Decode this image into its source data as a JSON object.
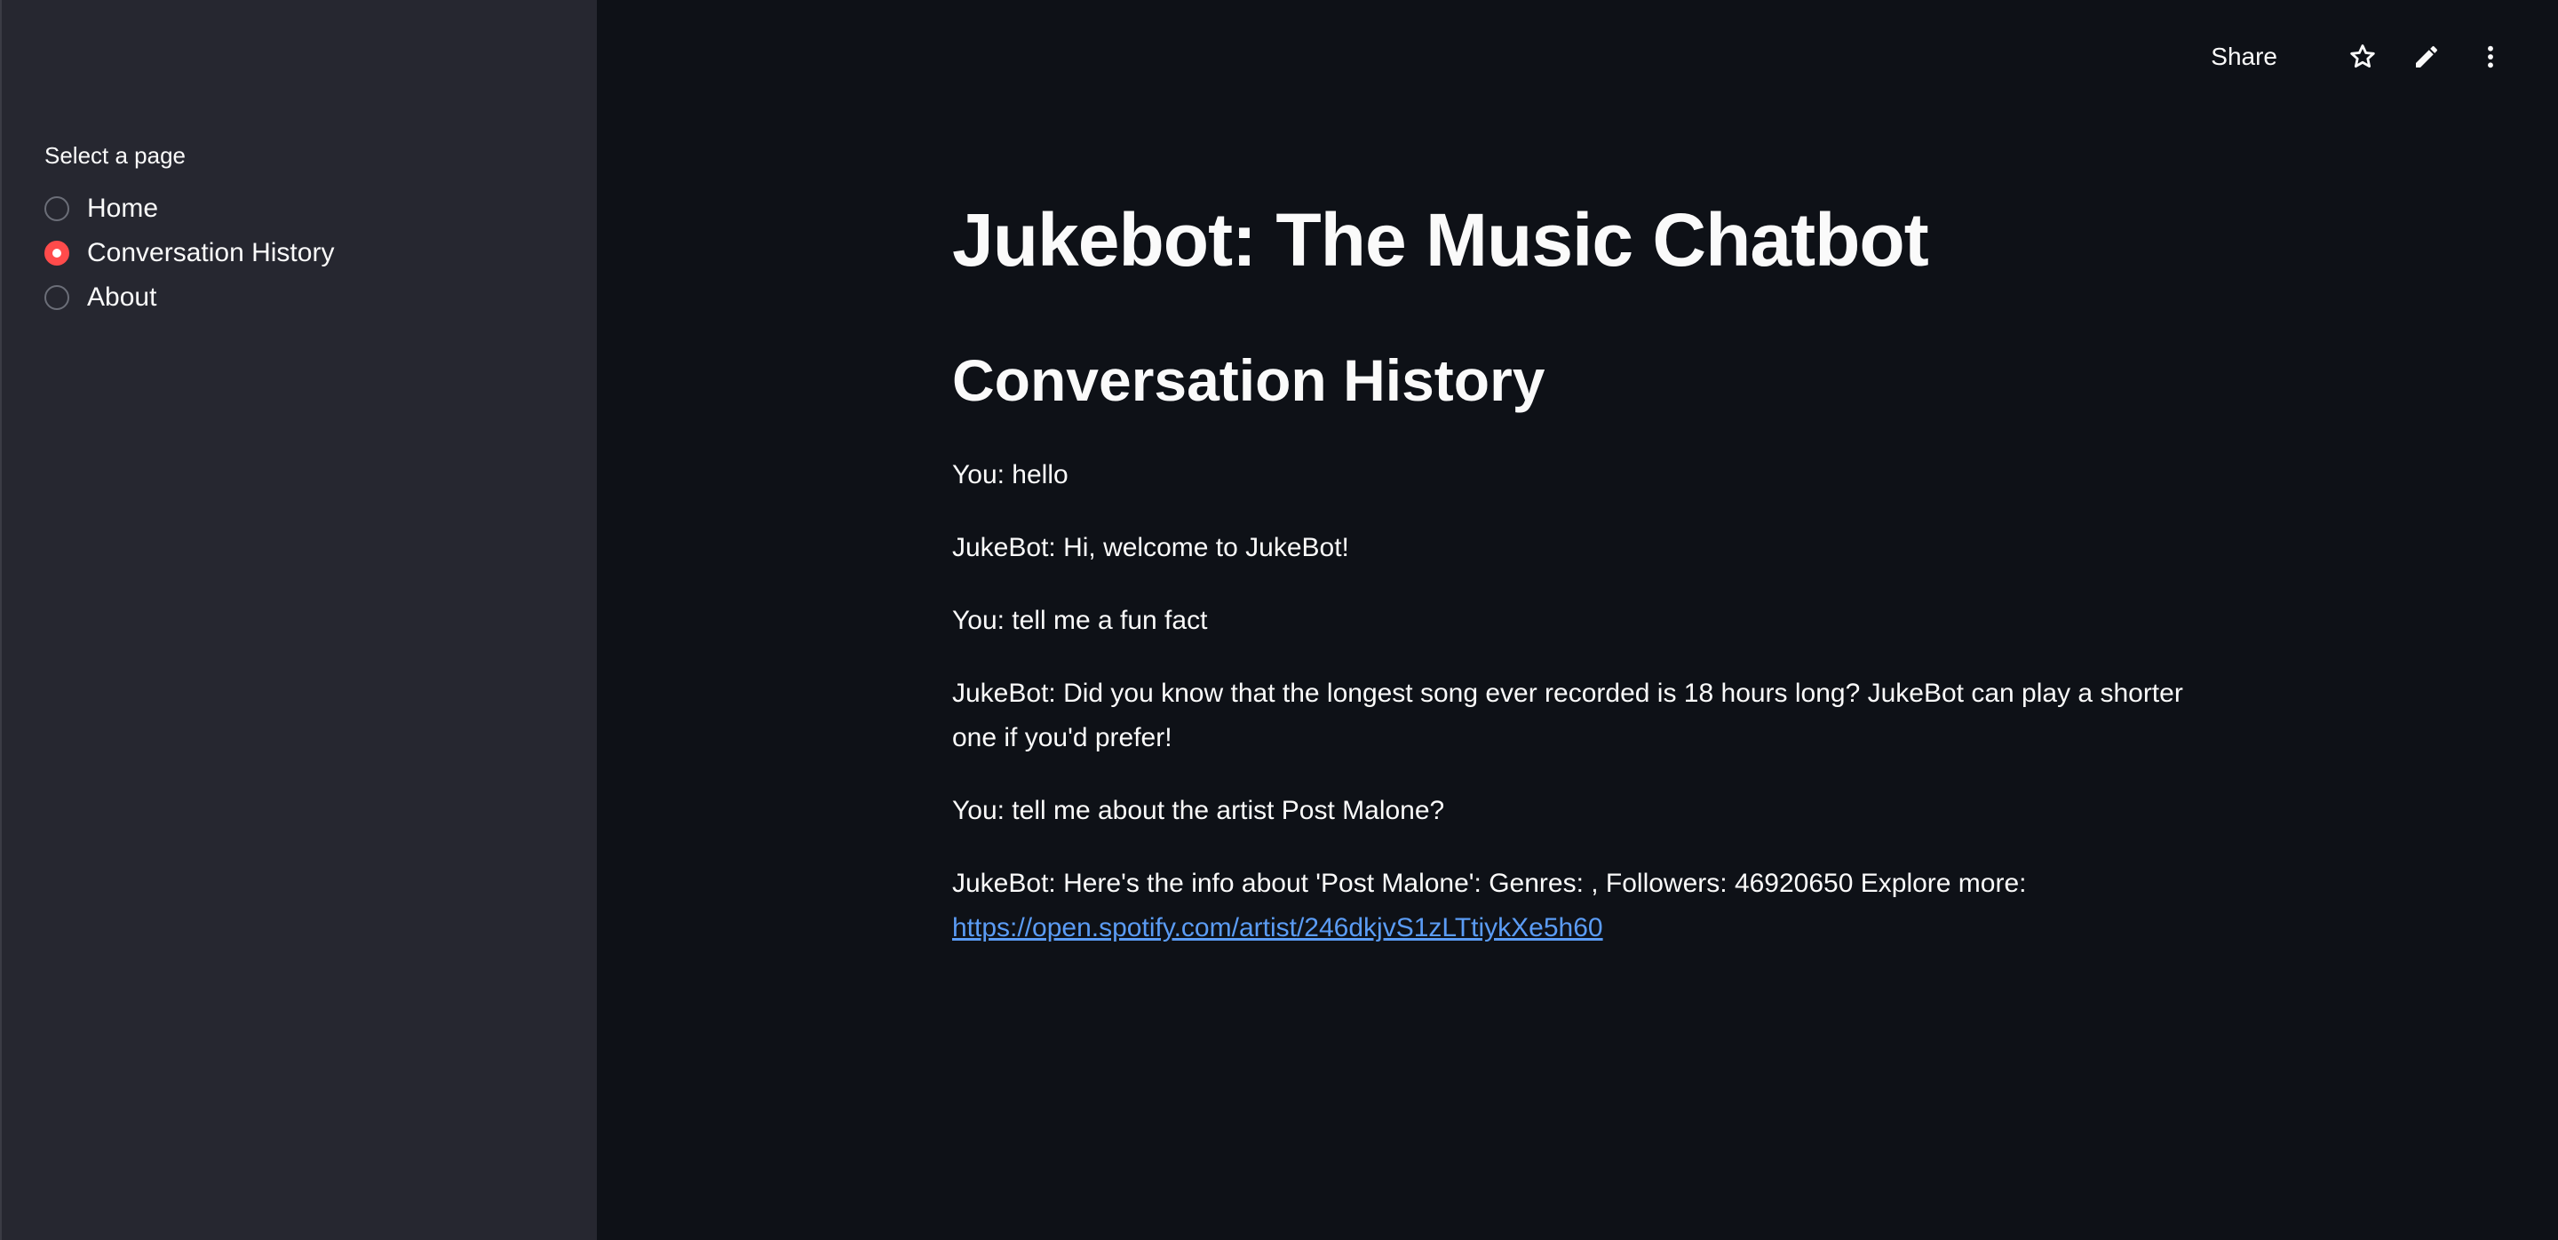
{
  "sidebar": {
    "label": "Select a page",
    "options": [
      {
        "label": "Home",
        "selected": false
      },
      {
        "label": "Conversation History",
        "selected": true
      },
      {
        "label": "About",
        "selected": false
      }
    ]
  },
  "toolbar": {
    "share_label": "Share",
    "icons": [
      "star-icon",
      "edit-pencil-icon",
      "more-vertical-icon"
    ]
  },
  "main": {
    "title": "Jukebot: The Music Chatbot",
    "subtitle": "Conversation History",
    "messages": [
      {
        "text": "You: hello"
      },
      {
        "text": "JukeBot: Hi, welcome to JukeBot!"
      },
      {
        "text": "You: tell me a fun fact"
      },
      {
        "text": "JukeBot: Did you know that the longest song ever recorded is 18 hours long? JukeBot can play a shorter one if you'd prefer!"
      },
      {
        "text": "You: tell me about the artist Post Malone?"
      },
      {
        "text": "JukeBot: Here's the info about 'Post Malone': Genres: , Followers: 46920650 Explore more:",
        "link": "https://open.spotify.com/artist/246dkjvS1zLTtiykXe5h60"
      }
    ]
  },
  "colors": {
    "background": "#0e1117",
    "sidebar": "#262730",
    "accent": "#ff4b4b",
    "link": "#5b9cf5",
    "text": "#fafafa"
  }
}
